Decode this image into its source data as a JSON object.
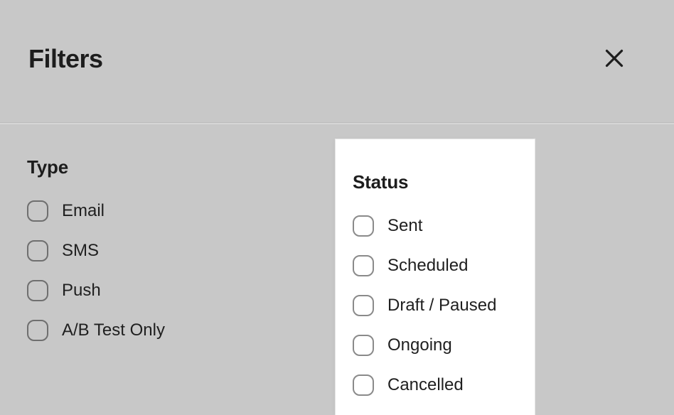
{
  "header": {
    "title": "Filters",
    "close_icon": "close-icon",
    "close_label": "Close"
  },
  "groups": [
    {
      "key": "type",
      "heading": "Type",
      "options": [
        {
          "label": "Email",
          "checked": false
        },
        {
          "label": "SMS",
          "checked": false
        },
        {
          "label": "Push",
          "checked": false
        },
        {
          "label": "A/B Test Only",
          "checked": false
        }
      ]
    },
    {
      "key": "status",
      "heading": "Status",
      "options": [
        {
          "label": "Sent",
          "checked": false
        },
        {
          "label": "Scheduled",
          "checked": false
        },
        {
          "label": "Draft / Paused",
          "checked": false
        },
        {
          "label": "Ongoing",
          "checked": false
        },
        {
          "label": "Cancelled",
          "checked": false
        }
      ]
    }
  ],
  "colors": {
    "background": "#c8c8c8",
    "card": "#ffffff",
    "text": "#1f1f1f",
    "heading": "#1d1d1d",
    "checkbox_border": "#6f6f6f",
    "divider": "#bdbdbd"
  }
}
